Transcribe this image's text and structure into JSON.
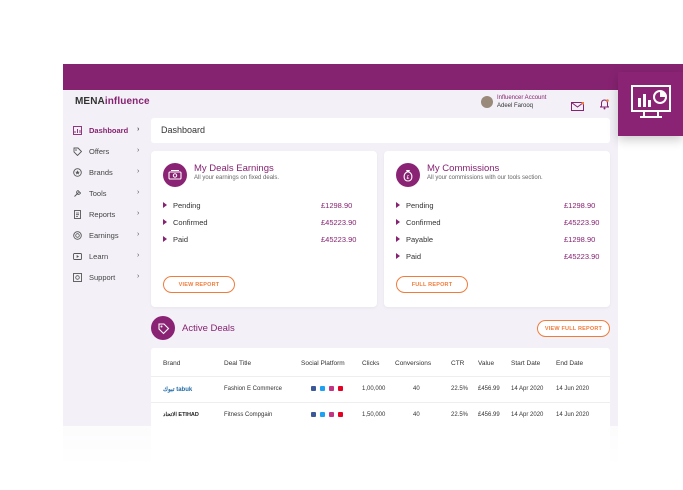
{
  "header": {
    "logo_main": "MENA",
    "logo_accent": "influence",
    "user_role": "Influencer Account",
    "user_name": "Adeel Farooq"
  },
  "sidebar": {
    "items": [
      {
        "label": "Dashboard",
        "icon": "chart-icon",
        "active": true
      },
      {
        "label": "Offers",
        "icon": "tag-icon"
      },
      {
        "label": "Brands",
        "icon": "badge-icon"
      },
      {
        "label": "Tools",
        "icon": "tools-icon"
      },
      {
        "label": "Reports",
        "icon": "report-icon"
      },
      {
        "label": "Earnings",
        "icon": "coin-icon"
      },
      {
        "label": "Learn",
        "icon": "video-icon"
      },
      {
        "label": "Support",
        "icon": "support-icon"
      }
    ],
    "chevron": "›"
  },
  "page": {
    "title": "Dashboard"
  },
  "deals_earnings": {
    "title": "My Deals Earnings",
    "subtitle": "All your earnings on fixed deals.",
    "rows": [
      {
        "label": "Pending",
        "value": "£1298.90"
      },
      {
        "label": "Confirmed",
        "value": "£45223.90"
      },
      {
        "label": "Paid",
        "value": "£45223.90"
      }
    ],
    "button": "VIEW REPORT"
  },
  "commissions": {
    "title": "My Commissions",
    "subtitle": "All your commissions with our tools section.",
    "rows": [
      {
        "label": "Pending",
        "value": "£1298.90"
      },
      {
        "label": "Confirmed",
        "value": "£45223.90"
      },
      {
        "label": "Payable",
        "value": "£1298.90"
      },
      {
        "label": "Paid",
        "value": "£45223.90"
      }
    ],
    "button": "FULL REPORT"
  },
  "active_deals": {
    "title": "Active Deals",
    "button": "VIEW FULL REPORT",
    "columns": [
      "Brand",
      "Deal Title",
      "Social Platform",
      "Clicks",
      "Conversions",
      "CTR",
      "Value",
      "Start Date",
      "End Date"
    ],
    "rows": [
      {
        "brand": "تبوك tabuk",
        "title": "Fashion E Commerce",
        "clicks": "1,00,000",
        "conversions": "40",
        "ctr": "22.5%",
        "value": "£456.99",
        "start": "14 Apr 2020",
        "end": "14 Jun 2020"
      },
      {
        "brand": "الاتحاد ETIHAD",
        "title": "Fitness Compgain",
        "clicks": "1,50,000",
        "conversions": "40",
        "ctr": "22.5%",
        "value": "£456.99",
        "start": "14 Apr 2020",
        "end": "14 Jun 2020"
      }
    ]
  },
  "colors": {
    "brand_purple": "#862371",
    "accent_orange": "#f07c3c",
    "background": "#f3f1f7"
  }
}
